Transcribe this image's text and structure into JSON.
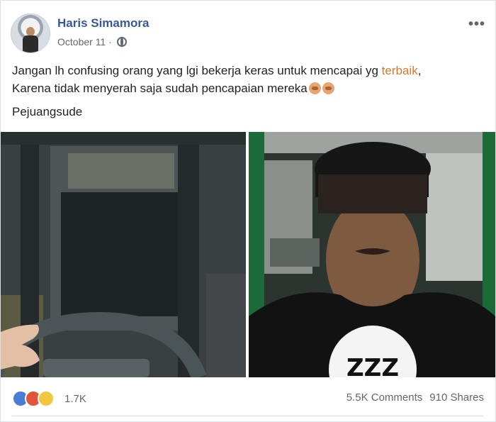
{
  "author": {
    "name": "Haris Simamora",
    "date": "October 11 ·"
  },
  "post": {
    "line1_before": "Jangan lh confusing orang yang lgi bekerja keras untuk mencapai yg ",
    "line1_highlight": "terbaik",
    "line1_after": ",",
    "line2": "Karena tidak menyerah saja sudah pencapaian mereka",
    "hashtag": "Pejuangsude"
  },
  "reactions": {
    "count": "1.7K",
    "types": [
      "like-icon",
      "angry-icon",
      "haha-icon"
    ]
  },
  "stats": {
    "comments": "5.5K Comments",
    "shares": "910 Shares"
  },
  "photos": {
    "shirt_text": "ZZZ"
  },
  "colors": {
    "name": "#365899",
    "highlight": "#d57a2b",
    "meta": "#616770"
  }
}
